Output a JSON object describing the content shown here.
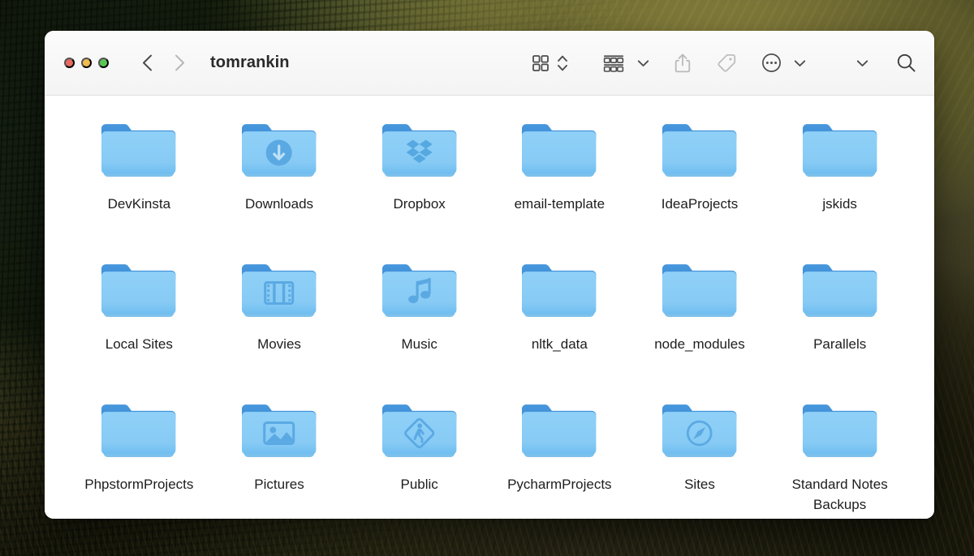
{
  "window": {
    "title": "tomrankin",
    "traffic_lights": [
      {
        "name": "close",
        "color": "#e8695e"
      },
      {
        "name": "minimize",
        "color": "#f0bc4e"
      },
      {
        "name": "zoom",
        "color": "#5bc653"
      }
    ]
  },
  "toolbar": {
    "back_label": "Back",
    "forward_label": "Forward",
    "view_icon": "grid-view-icon",
    "view_sort_icon": "chevron-up-down-icon",
    "group_icon": "group-items-icon",
    "group_chevron_icon": "chevron-down-icon",
    "share_icon": "share-icon",
    "tag_icon": "tag-icon",
    "more_icon": "ellipsis-circle-icon",
    "more_chevron_icon": "chevron-down-icon",
    "extra_chevron_icon": "chevron-down-icon",
    "search_icon": "search-icon"
  },
  "colors": {
    "folder_front": "#87cbf5",
    "folder_front_bottom": "#6fbdf0",
    "folder_tab": "#3d8fd8",
    "folder_badge": "#5ba9e3",
    "folder_badge_glyph": "#bde1f8",
    "toolbar_bg": "#f7f7f7",
    "content_bg": "#ffffff",
    "label_text": "#1d1d1d"
  },
  "files": [
    {
      "label": "DevKinsta",
      "badge": "none"
    },
    {
      "label": "Downloads",
      "badge": "download-arrow"
    },
    {
      "label": "Dropbox",
      "badge": "dropbox"
    },
    {
      "label": "email-template",
      "badge": "none"
    },
    {
      "label": "IdeaProjects",
      "badge": "none"
    },
    {
      "label": "jskids",
      "badge": "none"
    },
    {
      "label": "Local Sites",
      "badge": "none"
    },
    {
      "label": "Movies",
      "badge": "film"
    },
    {
      "label": "Music",
      "badge": "music-note"
    },
    {
      "label": "nltk_data",
      "badge": "none"
    },
    {
      "label": "node_modules",
      "badge": "none"
    },
    {
      "label": "Parallels",
      "badge": "none"
    },
    {
      "label": "PhpstormProjects",
      "badge": "none"
    },
    {
      "label": "Pictures",
      "badge": "photo"
    },
    {
      "label": "Public",
      "badge": "pedestrian"
    },
    {
      "label": "PycharmProjects",
      "badge": "none"
    },
    {
      "label": "Sites",
      "badge": "compass"
    },
    {
      "label": "Standard Notes Backups",
      "badge": "none"
    }
  ]
}
